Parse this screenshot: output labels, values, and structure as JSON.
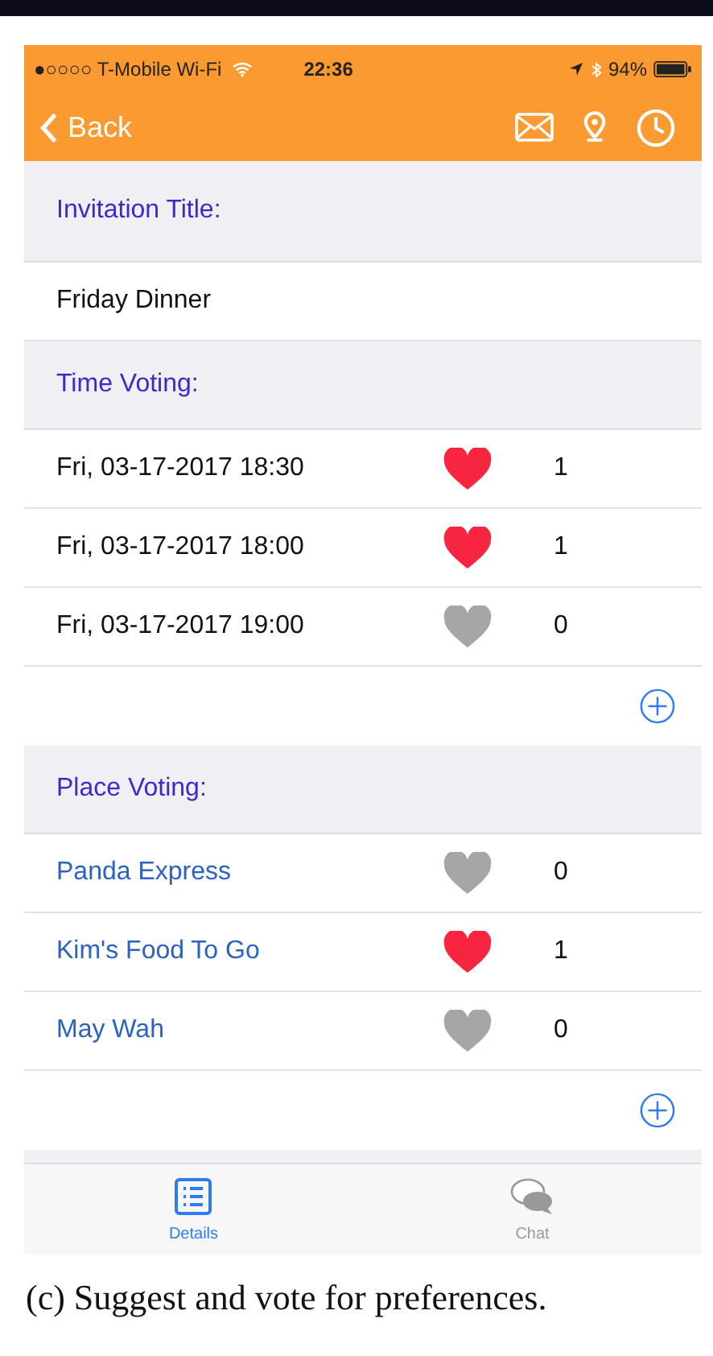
{
  "status_bar": {
    "carrier": "●○○○○ T-Mobile Wi-Fi",
    "time": "22:36",
    "battery": "94%"
  },
  "nav": {
    "back": "Back"
  },
  "title_section": {
    "header": "Invitation Title:",
    "value": "Friday Dinner"
  },
  "time_voting": {
    "header": "Time Voting:",
    "options": [
      {
        "label": "Fri, 03-17-2017 18:30",
        "liked": true,
        "count": "1"
      },
      {
        "label": "Fri, 03-17-2017 18:00",
        "liked": true,
        "count": "1"
      },
      {
        "label": "Fri, 03-17-2017 19:00",
        "liked": false,
        "count": "0"
      }
    ]
  },
  "place_voting": {
    "header": "Place Voting:",
    "options": [
      {
        "label": "Panda Express",
        "liked": false,
        "count": "0"
      },
      {
        "label": "Kim's Food To Go",
        "liked": true,
        "count": "1"
      },
      {
        "label": "May Wah",
        "liked": false,
        "count": "0"
      }
    ]
  },
  "tabs": [
    {
      "label": "Details",
      "selected": true
    },
    {
      "label": "Chat",
      "selected": false
    }
  ],
  "caption": "(c) Suggest and vote for preferences."
}
